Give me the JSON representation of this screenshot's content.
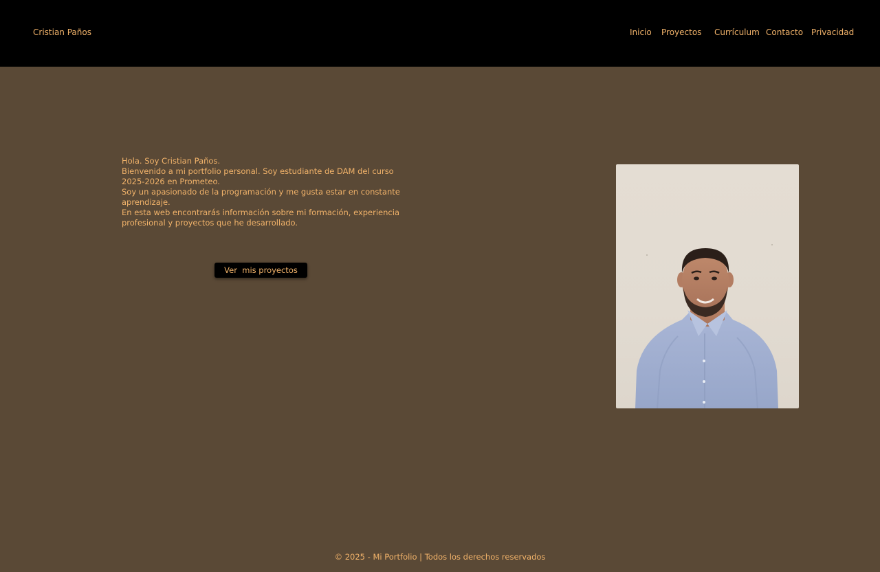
{
  "header": {
    "brand": "Cristian Paños",
    "nav": [
      "Inicio",
      "Proyectos",
      "Currículum",
      "Contacto",
      "Privacidad"
    ]
  },
  "intro": {
    "lines": [
      "Hola. Soy Cristian Paños.",
      "Bienvenido a mi portfolio personal. Soy estudiante de DAM del curso 2025-2026 en Prometeo.",
      "Soy un apasionado de la programación y me gusta estar en constante aprendizaje.",
      "En esta web encontrarás información sobre mi formación, experiencia profesional y proyectos que he desarrollado."
    ],
    "button_label": "Ver  mis proyectos"
  },
  "photo": {
    "icon": "profile-photo"
  },
  "footer": {
    "text": "© 2025 - Mi Portfolio | Todos los derechos reservados"
  },
  "colors": {
    "background": "#5a4936",
    "header": "#000000",
    "accent_text": "#f2b36a",
    "button": "#000000"
  }
}
